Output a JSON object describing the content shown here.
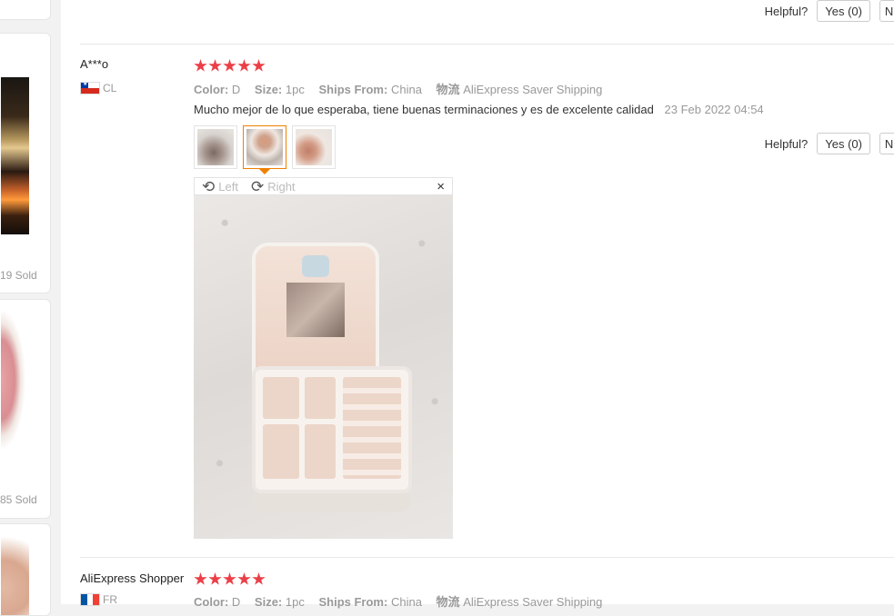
{
  "sidebar": {
    "sold_counts": [
      "19 Sold",
      "85 Sold"
    ]
  },
  "reviews": [
    {
      "helpful_label": "Helpful?",
      "yes_label": "Yes (0)",
      "no_label": "N"
    },
    {
      "user": "A***o",
      "country": "CL",
      "rating": 5,
      "color_label": "Color:",
      "color": "D",
      "size_label": "Size:",
      "size": "1pc",
      "ships_label": "Ships From:",
      "ships": "China",
      "logistics_label": "物流",
      "logistics": "AliExpress Saver Shipping",
      "feedback": "Mucho mejor de lo que esperaba, tiene buenas terminaciones y es de excelente calidad",
      "date": "23 Feb 2022 04:54",
      "helpful_label": "Helpful?",
      "yes_label": "Yes (0)",
      "no_label": "N",
      "viewer": {
        "rotate_left": "Left",
        "rotate_right": "Right",
        "close": "×"
      }
    },
    {
      "user": "AliExpress Shopper",
      "country": "FR",
      "rating": 5,
      "color_label": "Color:",
      "color": "D",
      "size_label": "Size:",
      "size": "1pc",
      "ships_label": "Ships From:",
      "ships": "China",
      "logistics_label": "物流",
      "logistics": "AliExpress Saver Shipping"
    }
  ],
  "colors": {
    "star": "#ec3e47",
    "active_thumb": "#f08000"
  }
}
